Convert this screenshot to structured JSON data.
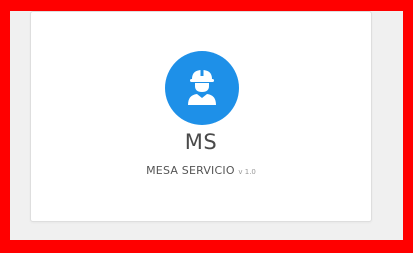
{
  "card": {
    "title": "MS",
    "subtitle": "MESA SERVICIO",
    "version": "v 1.0",
    "avatar_icon": "construction-worker-icon"
  },
  "colors": {
    "frame_border": "#ff0000",
    "avatar_bg": "#1e90e8",
    "card_bg": "#ffffff",
    "page_bg": "#f0f0f0"
  }
}
